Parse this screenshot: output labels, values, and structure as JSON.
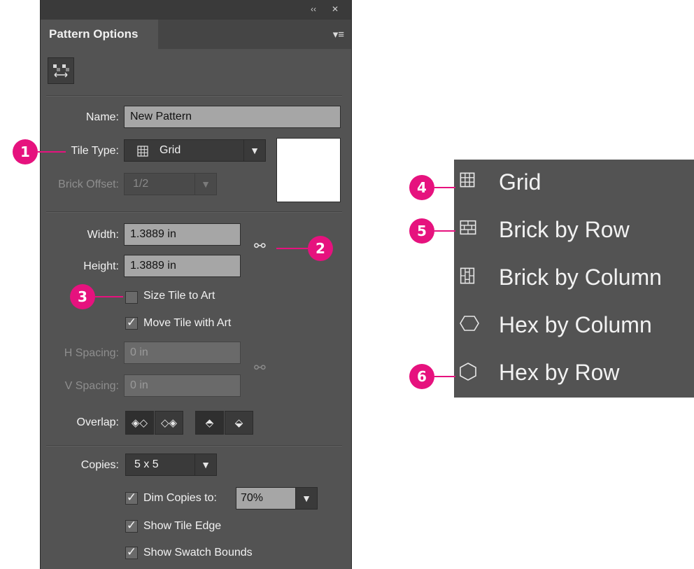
{
  "panel": {
    "title": "Pattern Options",
    "collapse_glyph": "‹‹",
    "close_glyph": "✕",
    "menu_glyph": "▾≡",
    "name_label": "Name:",
    "name_value": "New Pattern",
    "tile_type_label": "Tile Type:",
    "tile_type_icon": "grid-icon",
    "tile_type_value": "Grid",
    "brick_offset_label": "Brick Offset:",
    "brick_offset_value": "1/2",
    "width_label": "Width:",
    "width_value": "1.3889 in",
    "height_label": "Height:",
    "height_value": "1.3889 in",
    "size_tile_to_art_label": "Size Tile to Art",
    "size_tile_to_art_checked": false,
    "move_tile_with_art_label": "Move Tile with Art",
    "move_tile_with_art_checked": true,
    "h_spacing_label": "H Spacing:",
    "h_spacing_value": "0 in",
    "v_spacing_label": "V Spacing:",
    "v_spacing_value": "0 in",
    "overlap_label": "Overlap:",
    "copies_label": "Copies:",
    "copies_value": "5 x 5",
    "dim_copies_label": "Dim Copies to:",
    "dim_copies_checked": true,
    "dim_copies_value": "70%",
    "show_tile_edge_label": "Show Tile Edge",
    "show_tile_edge_checked": true,
    "show_swatch_bounds_label": "Show Swatch Bounds",
    "show_swatch_bounds_checked": true
  },
  "callouts": [
    "1",
    "2",
    "3",
    "4",
    "5",
    "6"
  ],
  "tile_type_menu": [
    {
      "label": "Grid",
      "icon": "grid-icon"
    },
    {
      "label": "Brick by Row",
      "icon": "brick-by-row-icon"
    },
    {
      "label": "Brick by Column",
      "icon": "brick-by-column-icon"
    },
    {
      "label": "Hex by Column",
      "icon": "hex-by-column-icon"
    },
    {
      "label": "Hex by Row",
      "icon": "hex-by-row-icon"
    }
  ],
  "colors": {
    "panel_bg": "#535353",
    "callout": "#e6127e"
  }
}
